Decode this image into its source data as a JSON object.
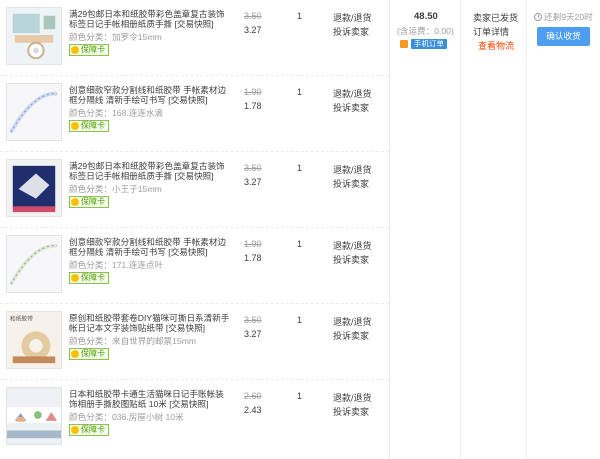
{
  "items": [
    {
      "title": "满29包邮日本和纸胶带彩色盖章复古装饰标签日记手帐相册纸质手撕 [交易快照]",
      "sku_label": "颜色分类：",
      "sku_value": "加罗令15mm",
      "badge": "保障卡",
      "price_original": "3.50",
      "price_current": "3.27",
      "quantity": "1",
      "action_refund": "退款/退货",
      "action_complain": "投诉卖家",
      "thumb_theme": "stamp-tape"
    },
    {
      "title": "创意细款窄款分割线和纸胶带 手帐素材边框分隔线 清新手绘可书写 [交易快照]",
      "sku_label": "颜色分类：",
      "sku_value": "168.连连水滴",
      "badge": "保障卡",
      "price_original": "1.90",
      "price_current": "1.78",
      "quantity": "1",
      "action_refund": "退款/退货",
      "action_complain": "投诉卖家",
      "thumb_theme": "thin-tape-blue"
    },
    {
      "title": "满29包邮日本和纸胶带彩色盖章复古装饰标签日记手帐相册纸质手撕 [交易快照]",
      "sku_label": "颜色分类：",
      "sku_value": "小王子15mm",
      "badge": "保障卡",
      "price_original": "3.50",
      "price_current": "3.27",
      "quantity": "1",
      "action_refund": "退款/退货",
      "action_complain": "投诉卖家",
      "thumb_theme": "prince-tape"
    },
    {
      "title": "创意细款窄款分割线和纸胶带 手帐素材边框分隔线 清新手绘可书写 [交易快照]",
      "sku_label": "颜色分类：",
      "sku_value": "171.连连点叶",
      "badge": "保障卡",
      "price_original": "1.90",
      "price_current": "1.78",
      "quantity": "1",
      "action_refund": "退款/退货",
      "action_complain": "投诉卖家",
      "thumb_theme": "thin-tape-green"
    },
    {
      "title": "原创和纸胶带套卷DIY猫咪可撕日系清新手帐日记本文字装饰贴纸带 [交易快照]",
      "sku_label": "颜色分类：",
      "sku_value": "来自世界的邮票15mm",
      "badge": "保障卡",
      "price_original": "3.50",
      "price_current": "3.27",
      "quantity": "1",
      "action_refund": "退款/退货",
      "action_complain": "投诉卖家",
      "thumb_theme": "stamps-tape",
      "thumb_text": "和纸胶带"
    },
    {
      "title": "日本和纸胶带卡通生活猫咪日记手账帐装饰相册手撕胶图贴纸 10米 [交易快照]",
      "sku_label": "颜色分类：",
      "sku_value": "036.房屋小树 10米",
      "badge": "保障卡",
      "price_original": "2.60",
      "price_current": "2.43",
      "quantity": "1",
      "action_refund": "退款/退货",
      "action_complain": "投诉卖家",
      "thumb_theme": "house-tape"
    }
  ],
  "order": {
    "total": "48.50",
    "shipping": "(含运费：0.00)",
    "mobile_tag": "手机订单",
    "status_line1": "卖家已发货",
    "status_line2": "订单详情",
    "status_line3": "查看物流",
    "remaining_time": "还剩9天20时",
    "confirm_button": "确认收货"
  },
  "colors": {
    "accent_blue": "#4d9ef0",
    "logistics_link": "#ff4400",
    "muted_text": "#9c9c9c",
    "badge_green": "#4b9a00"
  }
}
